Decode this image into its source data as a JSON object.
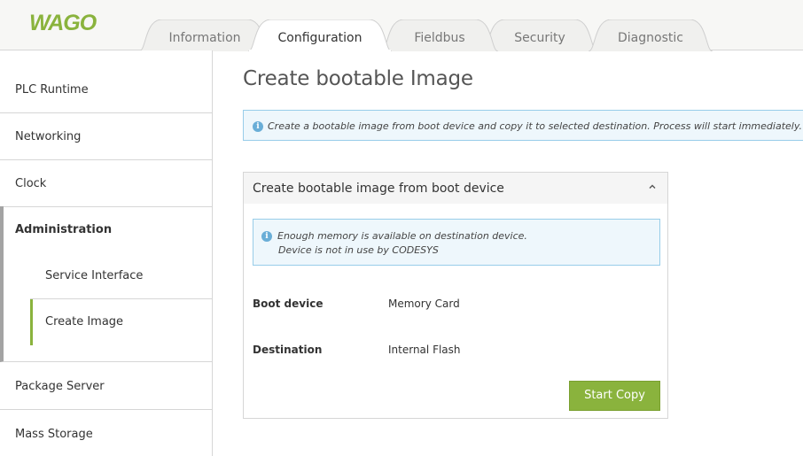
{
  "brand": {
    "logo_text": "WAGO",
    "color": "#8ab33d"
  },
  "tabs": [
    {
      "label": "Information",
      "active": false
    },
    {
      "label": "Configuration",
      "active": true
    },
    {
      "label": "Fieldbus",
      "active": false
    },
    {
      "label": "Security",
      "active": false
    },
    {
      "label": "Diagnostic",
      "active": false
    }
  ],
  "sidebar": {
    "items": [
      {
        "label": "PLC Runtime"
      },
      {
        "label": "Networking"
      },
      {
        "label": "Clock"
      },
      {
        "label": "Administration",
        "expanded": true
      },
      {
        "label": "Package Server"
      },
      {
        "label": "Mass Storage"
      }
    ],
    "sub_items": [
      {
        "label": "Service Interface",
        "active": false
      },
      {
        "label": "Create Image",
        "active": true
      }
    ]
  },
  "main": {
    "title": "Create bootable Image",
    "info": "Create a bootable image from boot device and copy it to selected destination. Process will start immediately.",
    "panel": {
      "title": "Create bootable image from boot device",
      "collapse_icon": "chevron-up-icon",
      "info_lines": [
        "Enough memory is available on destination device.",
        "Device is not in use by CODESYS"
      ],
      "fields": [
        {
          "label": "Boot device",
          "value": "Memory Card"
        },
        {
          "label": "Destination",
          "value": "Internal Flash"
        }
      ],
      "button_label": "Start Copy"
    }
  },
  "colors": {
    "accent": "#8ab33d",
    "info_bg": "#eef7fc",
    "info_border": "#98cde9",
    "info_icon": "#6aaed7"
  }
}
